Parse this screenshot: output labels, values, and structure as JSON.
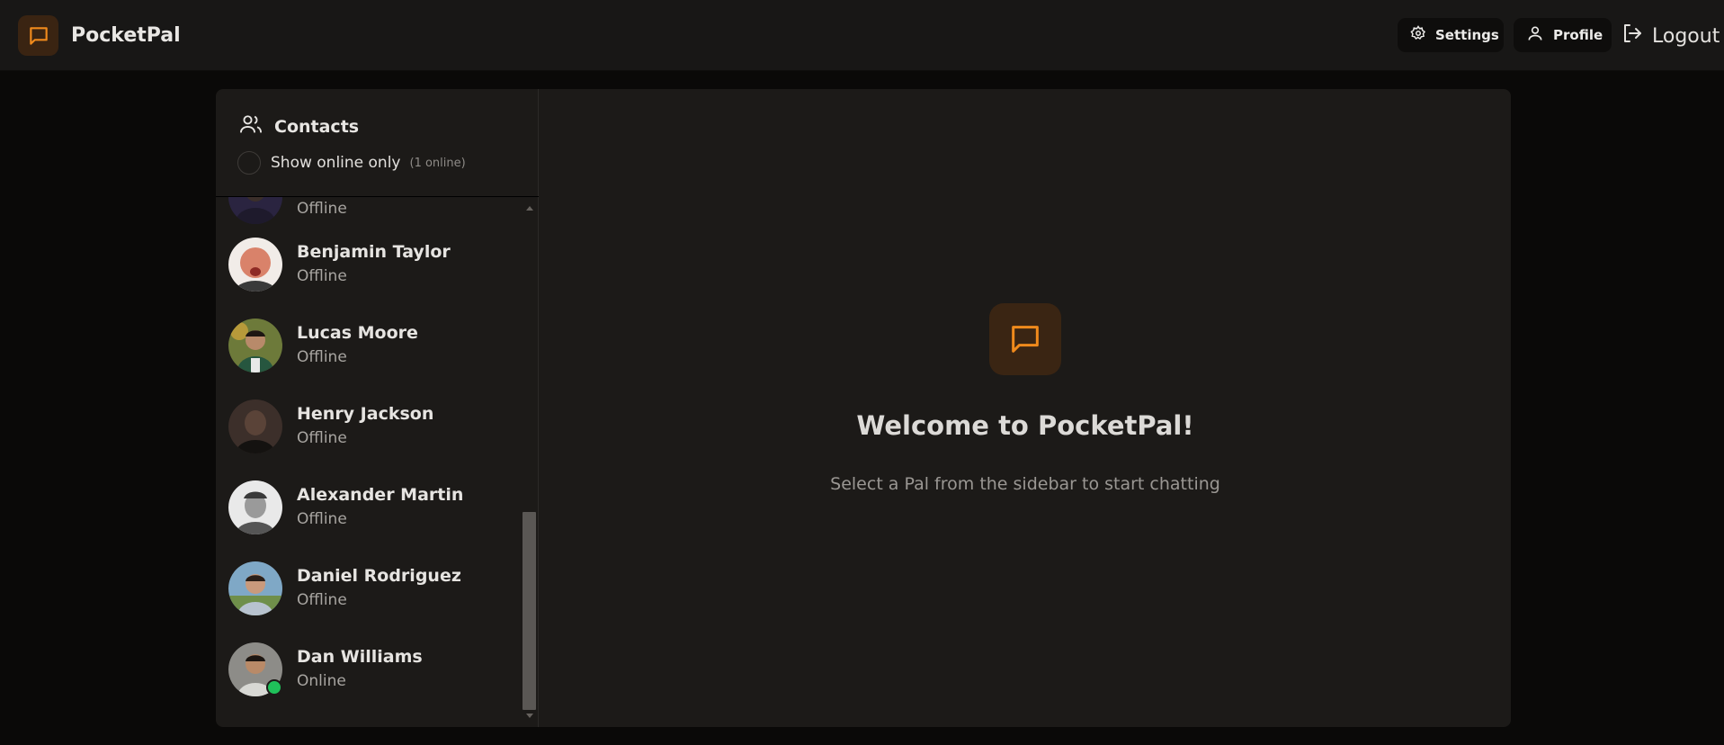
{
  "app": {
    "name": "PocketPal",
    "accent": "#f08a1c"
  },
  "nav": {
    "settings_label": "Settings",
    "profile_label": "Profile",
    "logout_label": "Logout"
  },
  "sidebar": {
    "title": "Contacts",
    "filter_label": "Show online only",
    "online_count": "(1 online)",
    "contacts": [
      {
        "name": "",
        "status": "Offline",
        "avatar_color": "#2a2440"
      },
      {
        "name": "Benjamin Taylor",
        "status": "Offline",
        "avatar_color": "#d9826a"
      },
      {
        "name": "Lucas Moore",
        "status": "Offline",
        "avatar_color": "#6d7a3a"
      },
      {
        "name": "Henry Jackson",
        "status": "Offline",
        "avatar_color": "#5a4338"
      },
      {
        "name": "Alexander Martin",
        "status": "Offline",
        "avatar_color": "#9a9a9a"
      },
      {
        "name": "Daniel Rodriguez",
        "status": "Offline",
        "avatar_color": "#7fa8c6"
      },
      {
        "name": "Dan Williams",
        "status": "Online",
        "avatar_color": "#8d8c88",
        "online_color": "#1fc15a"
      }
    ]
  },
  "welcome": {
    "title": "Welcome to PocketPal!",
    "subtitle": "Select a Pal from the sidebar to start chatting"
  },
  "icons": {
    "logo": "chat-bubble-icon",
    "settings": "gear-icon",
    "profile": "user-icon",
    "logout": "logout-icon",
    "contacts": "users-icon"
  }
}
